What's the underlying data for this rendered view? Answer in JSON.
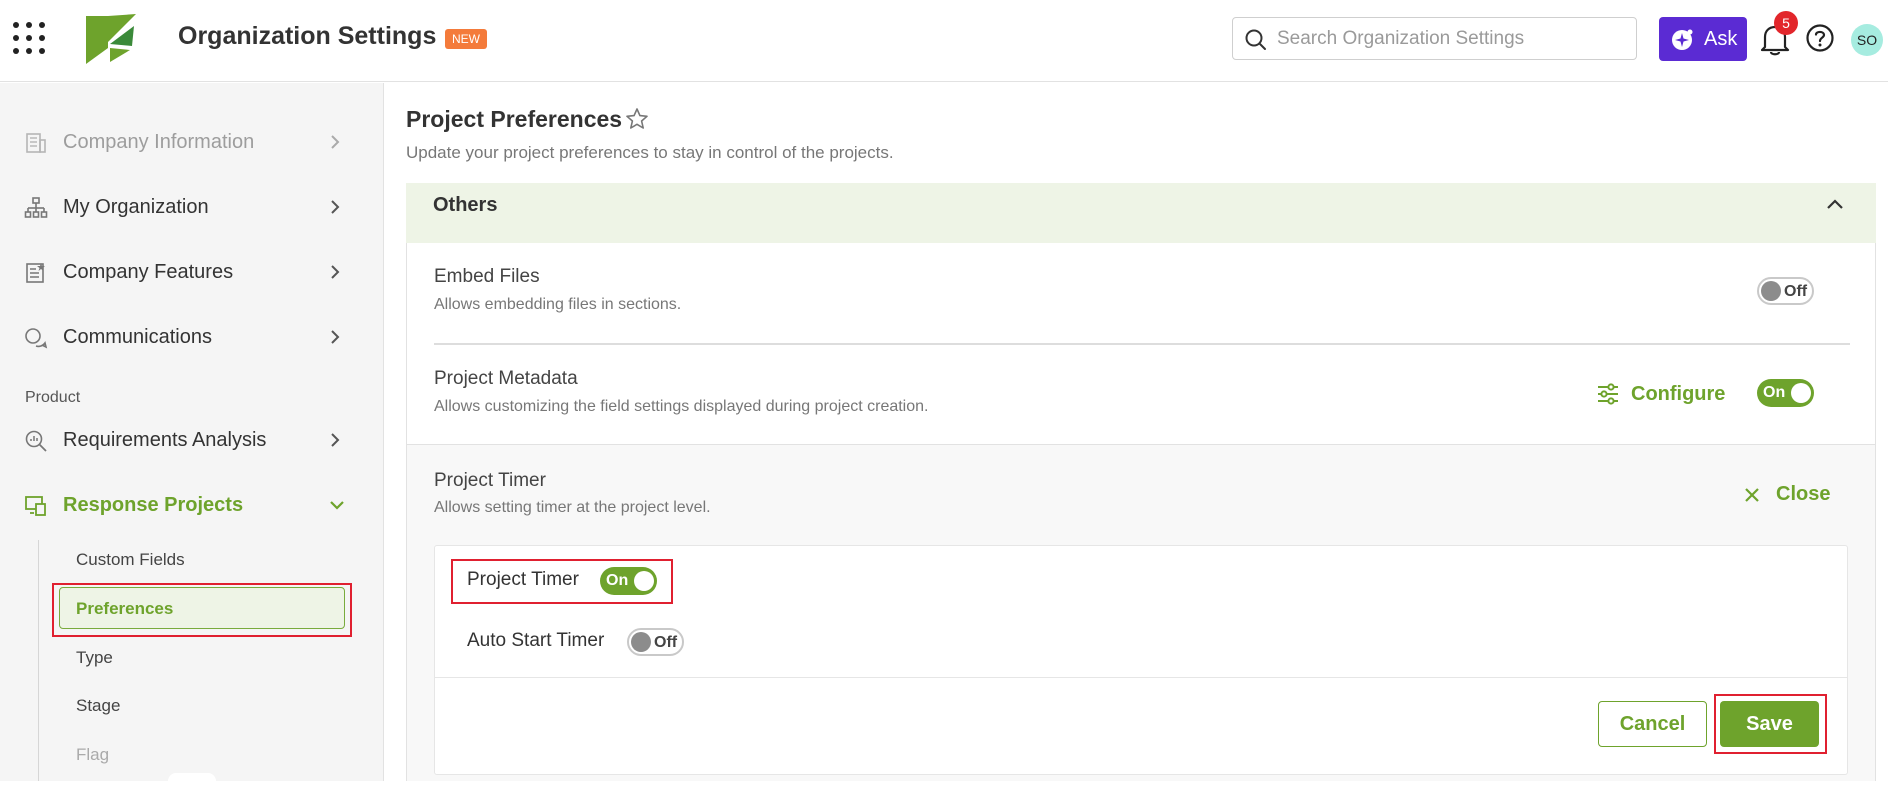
{
  "header": {
    "app_title": "Organization Settings",
    "new_badge": "NEW",
    "search_placeholder": "Search Organization Settings",
    "ask_label": "Ask",
    "notification_count": "5",
    "avatar_initials": "SO"
  },
  "sidebar": {
    "items": [
      {
        "label": "Company Information",
        "icon": "building-icon",
        "state": "disabled"
      },
      {
        "label": "My Organization",
        "icon": "org-chart-icon"
      },
      {
        "label": "Company Features",
        "icon": "features-list-icon"
      },
      {
        "label": "Communications",
        "icon": "chat-bubbles-icon"
      }
    ],
    "section_product": "Product",
    "product_items": [
      {
        "label": "Requirements Analysis",
        "icon": "search-analysis-icon"
      },
      {
        "label": "Response Projects",
        "icon": "projects-icon",
        "state": "active-expanded"
      }
    ],
    "sub_items": {
      "custom_fields": "Custom Fields",
      "preferences": "Preferences",
      "type": "Type",
      "stage": "Stage",
      "flag": "Flag"
    }
  },
  "main": {
    "title": "Project Preferences",
    "subtitle": "Update your project preferences to stay in control of the projects.",
    "section": "Others",
    "rows": {
      "embed_files": {
        "title": "Embed Files",
        "desc": "Allows embedding files in sections.",
        "toggle": "Off"
      },
      "project_metadata": {
        "title": "Project Metadata",
        "desc": "Allows customizing the field settings displayed during project creation.",
        "configure": "Configure",
        "toggle": "On"
      },
      "project_timer": {
        "title": "Project Timer",
        "desc": "Allows setting timer at the project level.",
        "close": "Close"
      }
    },
    "timer_options": {
      "project_timer": {
        "label": "Project Timer",
        "toggle": "On"
      },
      "auto_start": {
        "label": "Auto Start Timer",
        "toggle": "Off"
      }
    },
    "cancel": "Cancel",
    "save": "Save"
  },
  "colors": {
    "accent_green": "#6ea32c",
    "ask_purple": "#5b2bd3",
    "new_orange": "#f47b3b",
    "badge_red": "#e2262b",
    "highlight_red": "#e02030"
  }
}
